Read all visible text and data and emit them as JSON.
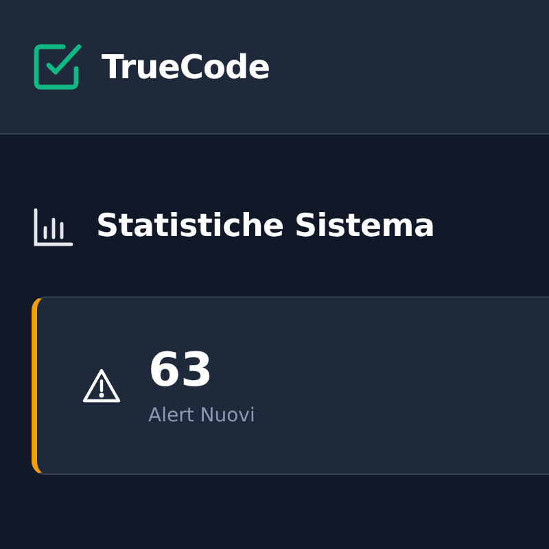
{
  "header": {
    "brand": "TrueCode"
  },
  "section": {
    "title": "Statistiche Sistema"
  },
  "stats": [
    {
      "value": "63",
      "label": "Alert Nuovi",
      "color": "#f59e0b",
      "kind": "warning"
    }
  ]
}
